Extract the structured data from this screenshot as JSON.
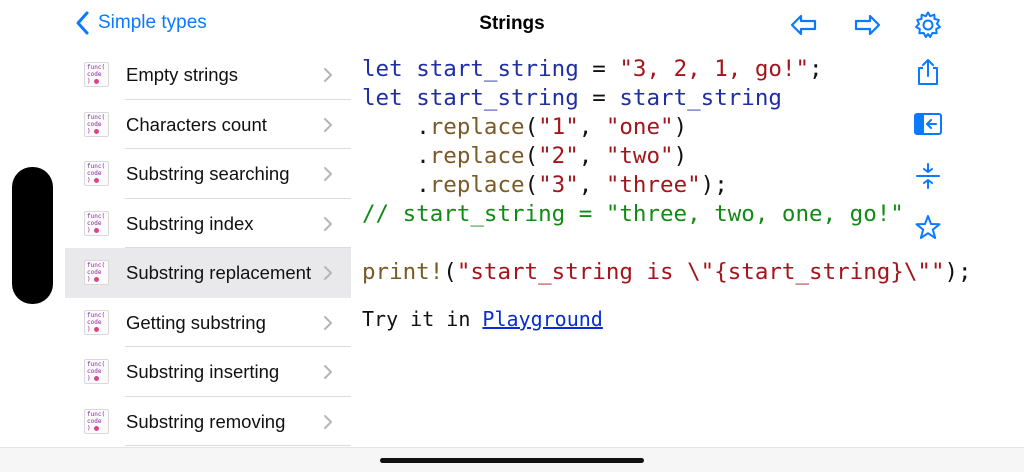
{
  "header": {
    "back_label": "Simple types",
    "title": "Strings"
  },
  "sidebar": {
    "thumb_text": [
      "func(",
      "code",
      ")"
    ],
    "items": [
      {
        "label": "Empty strings"
      },
      {
        "label": "Characters count"
      },
      {
        "label": "Substring searching"
      },
      {
        "label": "Substring index"
      },
      {
        "label": "Substring replacement",
        "selected": true
      },
      {
        "label": "Getting substring"
      },
      {
        "label": "Substring inserting"
      },
      {
        "label": "Substring removing"
      }
    ]
  },
  "code": {
    "l1": {
      "kw": "let",
      "sp": " ",
      "id": "start_string",
      "eq": " = ",
      "str": "\"3, 2, 1, go!\"",
      "end": ";"
    },
    "l2": {
      "kw": "let",
      "sp": " ",
      "id": "start_string",
      "eq": " = ",
      "id2": "start_string"
    },
    "l3": {
      "indent": "    ",
      "dot": ".",
      "fn": "replace",
      "open": "(",
      "a": "\"1\"",
      "comma": ", ",
      "b": "\"one\"",
      "close": ")"
    },
    "l4": {
      "indent": "    ",
      "dot": ".",
      "fn": "replace",
      "open": "(",
      "a": "\"2\"",
      "comma": ", ",
      "b": "\"two\"",
      "close": ")"
    },
    "l5": {
      "indent": "    ",
      "dot": ".",
      "fn": "replace",
      "open": "(",
      "a": "\"3\"",
      "comma": ", ",
      "b": "\"three\"",
      "close": ");"
    },
    "l6": {
      "comment": "// start_string = \"three, two, one, go!\""
    },
    "l7": {
      "fn": "print!",
      "open": "(",
      "str": "\"start_string is \\\"{start_string}\\\"\"",
      "close": ");"
    }
  },
  "try": {
    "prefix": "Try it in ",
    "link": "Playground"
  },
  "icons": {
    "back": "chevron-left-icon",
    "prev": "arrow-left-icon",
    "next": "arrow-right-icon",
    "settings": "gear-icon",
    "share": "share-icon",
    "sidebar": "sidebar-toggle-icon",
    "collapse": "collapse-icon",
    "favorite": "star-icon"
  },
  "colors": {
    "accent": "#0a7aff",
    "keyword": "#1f2fa3",
    "string": "#a3151c",
    "function": "#7a5a26",
    "comment": "#138a16",
    "selected_row": "#e9e9ec"
  }
}
